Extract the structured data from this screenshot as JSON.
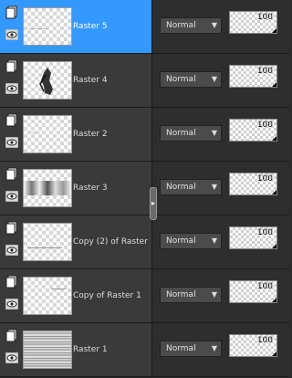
{
  "layers": [
    {
      "name": "Raster 5",
      "blend_mode": "Normal",
      "opacity": "100",
      "selected": true
    },
    {
      "name": "Raster 4",
      "blend_mode": "Normal",
      "opacity": "100",
      "selected": false
    },
    {
      "name": "Raster 2",
      "blend_mode": "Normal",
      "opacity": "100",
      "selected": false
    },
    {
      "name": "Raster 3",
      "blend_mode": "Normal",
      "opacity": "100",
      "selected": false
    },
    {
      "name": "Copy (2) of Raster 1",
      "blend_mode": "Normal",
      "opacity": "100",
      "selected": false
    },
    {
      "name": "Copy of Raster 1",
      "blend_mode": "Normal",
      "opacity": "100",
      "selected": false
    },
    {
      "name": "Raster 1",
      "blend_mode": "Normal",
      "opacity": "100",
      "selected": false
    }
  ],
  "icons": {
    "visibility": "eye-icon",
    "layer_type": "raster-layer-icon",
    "dropdown": "chevron-down-icon",
    "collapse": "chevron-right-icon"
  },
  "colors": {
    "selection": "#3399ff",
    "panel": "#3a3a3a",
    "background": "#2b2b2b"
  }
}
